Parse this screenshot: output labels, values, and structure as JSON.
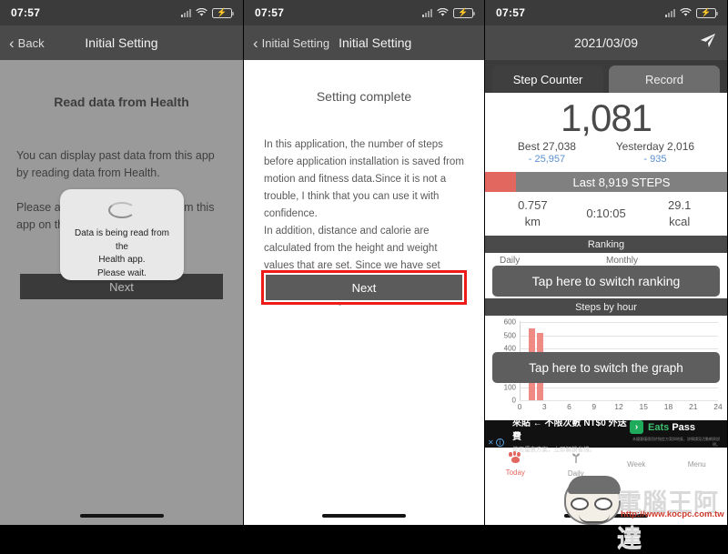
{
  "status_bar": {
    "time": "07:57",
    "signal_icon": "signal-bars-icon",
    "wifi_icon": "wifi-icon",
    "battery_icon": "battery-charging-icon"
  },
  "panel1": {
    "nav": {
      "back_label": "Back",
      "title": "Initial Setting",
      "back_icon": "chevron-left-icon"
    },
    "heading": "Read data from Health",
    "paragraph1": "You can display past data from this app by reading data from Health.",
    "paragraph2": "Please allow access to Health from this app on the next screen.",
    "next_label": "Next",
    "modal": {
      "spinner_icon": "loading-spinner-icon",
      "line1": "Data is being read from the",
      "line2": "Health app.",
      "line3": "Please wait."
    }
  },
  "panel2": {
    "nav": {
      "back_label": "Initial Setting",
      "title": "Initial Setting",
      "back_icon": "chevron-left-icon"
    },
    "heading": "Setting complete",
    "paragraph": "In this application, the number of steps before application installation is saved from motion and fitness data.Since it is not a trouble, I think that you can use it with confidence.\nIn addition, distance and calorie are calculated from the height and weight values that are set. Since we have set provisional values now, please set from POPOPO setting menu.",
    "next_label": "Next",
    "highlight_color": "#ee1c18"
  },
  "panel3": {
    "nav": {
      "title": "2021/03/09",
      "send_icon": "paper-plane-icon"
    },
    "tabs": [
      {
        "label": "Step Counter",
        "active": true
      },
      {
        "label": "Record",
        "active": false
      }
    ],
    "steps_today": "1,081",
    "best": {
      "label": "Best 27,038",
      "delta": "- 25,957"
    },
    "yesterday": {
      "label": "Yesterday 2,016",
      "delta": "- 935"
    },
    "last_steps": "Last 8,919 STEPS",
    "metrics": [
      {
        "value": "0.757",
        "unit": "km"
      },
      {
        "value": "0:10:05",
        "unit": ""
      },
      {
        "value": "29.1",
        "unit": "kcal"
      }
    ],
    "ranking": {
      "section_title": "Ranking",
      "daily_label": "Daily",
      "monthly_label": "Monthly",
      "overlay": "Tap here to switch ranking"
    },
    "graph": {
      "section_title": "Steps by hour",
      "overlay": "Tap here to switch the graph"
    },
    "ad": {
      "close_icon": "close-icon",
      "info_icon": "info-icon",
      "headline": "來貼 ← 不限次數 NT$0 外送費",
      "subline": "使用優惠方案，立即解鎖省錢。",
      "brand_icon_glyph": "›",
      "brand_eats": "Eats",
      "brand_pass": "Pass",
      "fineprint": "本優惠僅適用於指定方案與地區，詳情請見活動網頁說明。"
    },
    "tabbar": [
      {
        "label": "Today",
        "icon": "paw-icon",
        "active": true
      },
      {
        "label": "Daily",
        "icon": "sprout-icon",
        "active": false
      },
      {
        "label": "Week",
        "icon": "calendar-icon",
        "active": false
      },
      {
        "label": "Menu",
        "icon": "menu-icon",
        "active": false
      }
    ],
    "accent_color": "#e2675f",
    "link_color": "#5a8fd0"
  },
  "chart_data": {
    "type": "bar",
    "title": "Steps by hour",
    "xlabel": "",
    "ylabel": "",
    "categories": [
      0,
      1,
      2,
      3,
      4,
      5,
      6,
      7,
      8,
      9,
      10,
      11,
      12,
      13,
      14,
      15,
      16,
      17,
      18,
      19,
      20,
      21,
      22,
      23
    ],
    "values": [
      0,
      550,
      520,
      0,
      0,
      0,
      0,
      0,
      0,
      0,
      0,
      0,
      0,
      0,
      0,
      0,
      0,
      0,
      0,
      0,
      0,
      0,
      0,
      0
    ],
    "ylim": [
      0,
      600
    ],
    "yticks": [
      0,
      100,
      200,
      300,
      400,
      500,
      600
    ],
    "xticks": [
      0,
      3,
      6,
      9,
      12,
      15,
      18,
      21,
      24
    ],
    "bar_color": "#ef8b84",
    "grid": true,
    "legend": false
  },
  "watermark": {
    "text": "電腦王阿達",
    "url": "http://www.kocpc.com.tw"
  }
}
